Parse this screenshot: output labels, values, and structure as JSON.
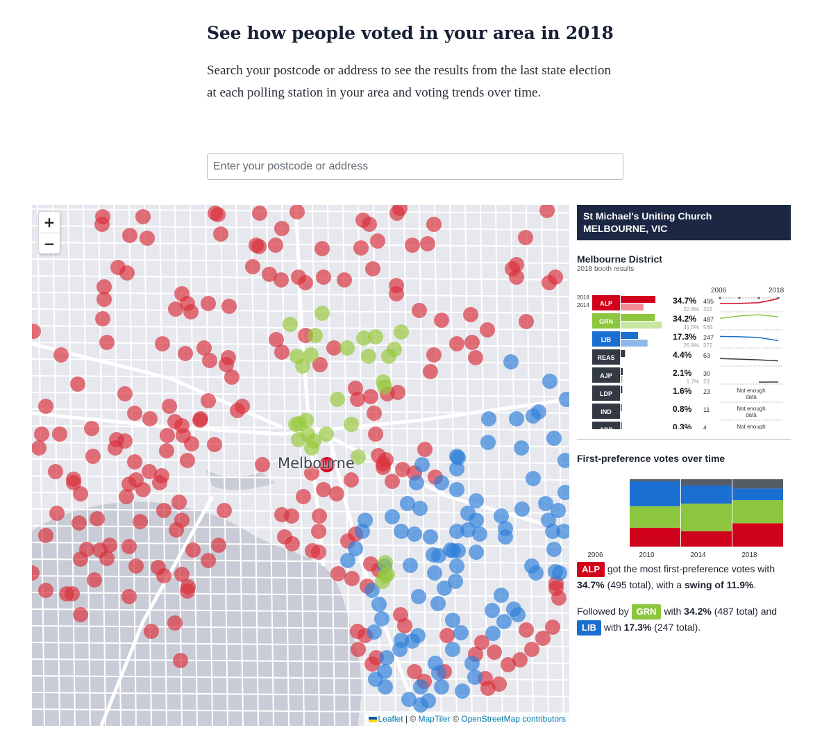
{
  "page": {
    "title": "See how people voted in your area in 2018",
    "intro": "Search your postcode or address to see the results from the last state election at each polling station in your area and voting trends over time."
  },
  "search": {
    "placeholder": "Enter your postcode or address",
    "value": ""
  },
  "map": {
    "zoom_in": "+",
    "zoom_out": "−",
    "city_label": "Melbourne",
    "attribution": {
      "leaflet": "Leaflet",
      "sep": " | © ",
      "maptiler": "MapTiler",
      "sep2": " © ",
      "osm": "OpenStreetMap contributors"
    },
    "colors": {
      "alp": "#d9303c",
      "grn": "#98c93c",
      "lib": "#2f7fd9",
      "selected": "#d0021b"
    }
  },
  "booth": {
    "name": "St Michael's Uniting Church",
    "location": "MELBOURNE, VIC",
    "district": "Melbourne District",
    "subtitle": "2018 booth results",
    "year_2018": "2018",
    "year_2014": "2014",
    "trend_start": "2006",
    "trend_end": "2018",
    "not_enough": "Not enough data",
    "parties": [
      {
        "code": "ALP",
        "color": "#d0021b",
        "light": "#f08d95",
        "pct2018": "34.7%",
        "votes2018": "495",
        "pct2014": "22.8%",
        "votes2014": "315",
        "v2018": 34.7,
        "v2014": 22.8,
        "trend": [
          20,
          21,
          22.8,
          34.7
        ]
      },
      {
        "code": "GRN",
        "color": "#8cc63f",
        "light": "#c8e6a0",
        "pct2018": "34.2%",
        "votes2018": "487",
        "pct2014": "41.0%",
        "votes2014": "566",
        "v2018": 34.2,
        "v2014": 41.0,
        "trend": [
          30,
          37,
          41.0,
          34.2
        ]
      },
      {
        "code": "LIB",
        "color": "#1b6fd1",
        "light": "#8fb8ea",
        "pct2018": "17.3%",
        "votes2018": "247",
        "pct2014": "26.9%",
        "votes2014": "372",
        "v2018": 17.3,
        "v2014": 26.9,
        "trend": [
          30,
          29,
          26.9,
          17.3
        ]
      },
      {
        "code": "REAS",
        "color": "#333a44",
        "light": "",
        "pct2018": "4.4%",
        "votes2018": "63",
        "pct2014": "",
        "votes2014": "",
        "v2018": 4.4,
        "v2014": 0,
        "trend": [
          18,
          16,
          14,
          11
        ]
      },
      {
        "code": "AJP",
        "color": "#333a44",
        "light": "#bbbbbb",
        "pct2018": "2.1%",
        "votes2018": "30",
        "pct2014": "1.7%",
        "votes2014": "23",
        "v2018": 2.1,
        "v2014": 1.7,
        "trend": [
          0,
          0,
          1.7,
          2.1
        ]
      },
      {
        "code": "LDP",
        "color": "#333a44",
        "light": "",
        "pct2018": "1.6%",
        "votes2018": "23",
        "pct2014": "",
        "votes2014": "",
        "v2018": 1.6,
        "v2014": 0,
        "trend": null
      },
      {
        "code": "IND",
        "color": "#333a44",
        "light": "",
        "pct2018": "0.8%",
        "votes2018": "11",
        "pct2014": "",
        "votes2014": "",
        "v2018": 0.8,
        "v2014": 0,
        "trend": null
      },
      {
        "code": "ABP",
        "color": "#333a44",
        "light": "",
        "pct2018": "0.3%",
        "votes2018": "4",
        "pct2014": "",
        "votes2014": "",
        "v2018": 0.3,
        "v2014": 0,
        "trend": null
      }
    ]
  },
  "fp_over_time": {
    "title": "First-preference votes over time",
    "years": [
      "2006",
      "2010",
      "2014",
      "2018"
    ],
    "stacks": [
      null,
      {
        "ALP": 28,
        "GRN": 32,
        "LIB": 37,
        "OTHER": 3
      },
      {
        "ALP": 22.8,
        "GRN": 41,
        "LIB": 26.9,
        "OTHER": 9.3
      },
      {
        "ALP": 34.7,
        "GRN": 34.2,
        "LIB": 17.3,
        "OTHER": 13.8
      }
    ],
    "colors": {
      "ALP": "#d0021b",
      "GRN": "#8cc63f",
      "LIB": "#1b6fd1",
      "OTHER": "#555c66"
    }
  },
  "summary": {
    "winner_code": "ALP",
    "winner_text": "got the most first-preference votes with",
    "winner_pct": "34.7%",
    "winner_total": "(495 total), with a",
    "swing": "swing of 11.9%",
    "swing_end": ".",
    "followed_by": "Followed by",
    "second_code": "GRN",
    "with1": "with",
    "second_pct": "34.2%",
    "second_total": "(487 total) and",
    "third_code": "LIB",
    "with2": "with",
    "third_pct": "17.3%",
    "third_total": "(247 total)."
  }
}
